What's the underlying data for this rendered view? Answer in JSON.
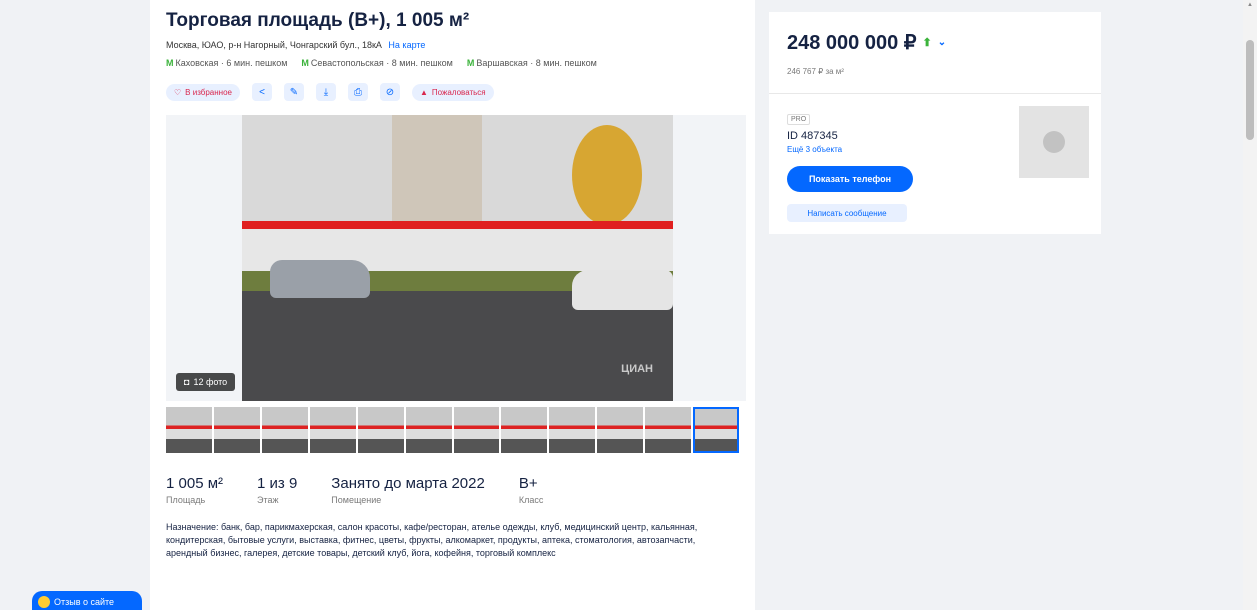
{
  "listing": {
    "title": "Торговая площадь (B+), 1 005 м²",
    "address": "Москва, ЮАО, р-н Нагорный, Чонгарский бул., 18кА",
    "map_link": "На карте",
    "metro": [
      {
        "station": "Каховская",
        "walk": "· 6 мин. пешком"
      },
      {
        "station": "Севастопольская",
        "walk": "· 8 мин. пешком"
      },
      {
        "station": "Варшавская",
        "walk": "· 8 мин. пешком"
      }
    ],
    "actions": {
      "favorite": "В избранное",
      "complain": "Пожаловаться"
    },
    "photo_count": "12 фото",
    "watermark": "ЦИАН",
    "params": [
      {
        "value": "1 005 м²",
        "label": "Площадь"
      },
      {
        "value": "1 из 9",
        "label": "Этаж"
      },
      {
        "value": "Занято до марта 2022",
        "label": "Помещение"
      },
      {
        "value": "B+",
        "label": "Класс"
      }
    ],
    "description": "Назначение: банк, бар, парикмахерская, салон красоты, кафе/ресторан, ателье одежды, клуб, медицинский центр, кальянная, кондитерская, бытовые услуги, выставка, фитнес, цветы, фрукты, алкомаркет, продукты, аптека, стоматология, автозапчасти, арендный бизнес, галерея, детские товары, детский клуб, йога, кофейня, торговый комплекс"
  },
  "sidebar": {
    "price": "248 000 000 ₽",
    "price_per_m2": "246 767 ₽ за м²",
    "pro_badge": "PRO",
    "agent_id": "ID 487345",
    "more_objects": "Ещё 3 объекта",
    "show_phone": "Показать телефон",
    "write_message": "Написать сообщение"
  },
  "feedback": "Отзыв о сайте"
}
